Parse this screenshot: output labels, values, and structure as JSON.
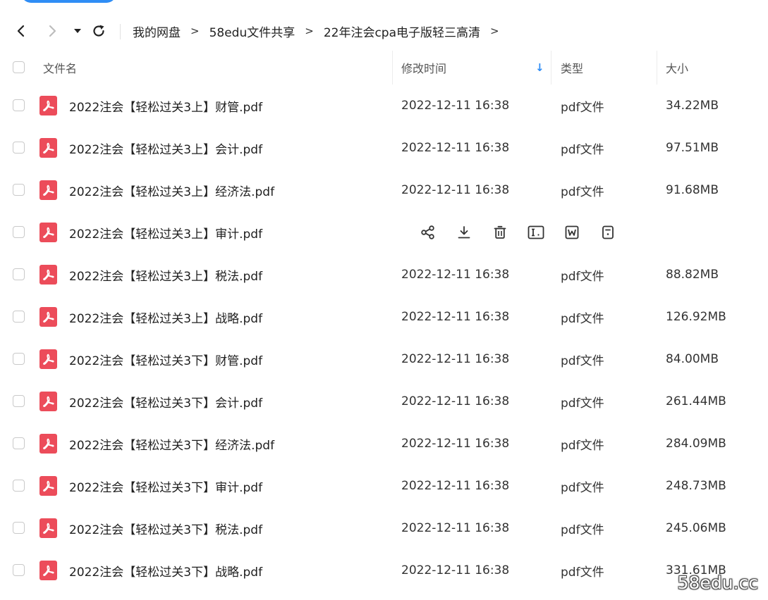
{
  "breadcrumb": [
    {
      "label": "我的网盘"
    },
    {
      "label": "58edu文件共享"
    },
    {
      "label": "22年注会cpa电子版轻三高清"
    }
  ],
  "breadcrumb_separator": ">",
  "table": {
    "columns": {
      "name": "文件名",
      "time": "修改时间",
      "type": "类型",
      "size": "大小"
    },
    "sort_indicator": "↓",
    "rows": [
      {
        "name": "2022注会【轻松过关3上】财管.pdf",
        "time": "2022-12-11 16:38",
        "type": "pdf文件",
        "size": "34.22MB"
      },
      {
        "name": "2022注会【轻松过关3上】会计.pdf",
        "time": "2022-12-11 16:38",
        "type": "pdf文件",
        "size": "97.51MB"
      },
      {
        "name": "2022注会【轻松过关3上】经济法.pdf",
        "time": "2022-12-11 16:38",
        "type": "pdf文件",
        "size": "91.68MB"
      },
      {
        "name": "2022注会【轻松过关3上】审计.pdf",
        "time": "",
        "type": "",
        "size": "",
        "hovered": true
      },
      {
        "name": "2022注会【轻松过关3上】税法.pdf",
        "time": "2022-12-11 16:38",
        "type": "pdf文件",
        "size": "88.82MB"
      },
      {
        "name": "2022注会【轻松过关3上】战略.pdf",
        "time": "2022-12-11 16:38",
        "type": "pdf文件",
        "size": "126.92MB"
      },
      {
        "name": "2022注会【轻松过关3下】财管.pdf",
        "time": "2022-12-11 16:38",
        "type": "pdf文件",
        "size": "84.00MB"
      },
      {
        "name": "2022注会【轻松过关3下】会计.pdf",
        "time": "2022-12-11 16:38",
        "type": "pdf文件",
        "size": "261.44MB"
      },
      {
        "name": "2022注会【轻松过关3下】经济法.pdf",
        "time": "2022-12-11 16:38",
        "type": "pdf文件",
        "size": "284.09MB"
      },
      {
        "name": "2022注会【轻松过关3下】审计.pdf",
        "time": "2022-12-11 16:38",
        "type": "pdf文件",
        "size": "248.73MB"
      },
      {
        "name": "2022注会【轻松过关3下】税法.pdf",
        "time": "2022-12-11 16:38",
        "type": "pdf文件",
        "size": "245.06MB"
      },
      {
        "name": "2022注会【轻松过关3下】战略.pdf",
        "time": "2022-12-11 16:38",
        "type": "pdf文件",
        "size": "331.61MB"
      }
    ],
    "row_actions": [
      "share-icon",
      "download-icon",
      "delete-icon",
      "rename-icon",
      "open-doc-icon",
      "more-icon"
    ]
  },
  "icons": {
    "back": "chevron-left-icon",
    "forward": "chevron-right-icon",
    "history": "caret-down-icon",
    "refresh": "refresh-icon",
    "file": "pdf-file-icon"
  },
  "colors": {
    "accent": "#2f8df5",
    "pdf_icon": "#ec4c5a",
    "sort_arrow": "#2f8df5"
  },
  "watermark": "58edu.cc"
}
